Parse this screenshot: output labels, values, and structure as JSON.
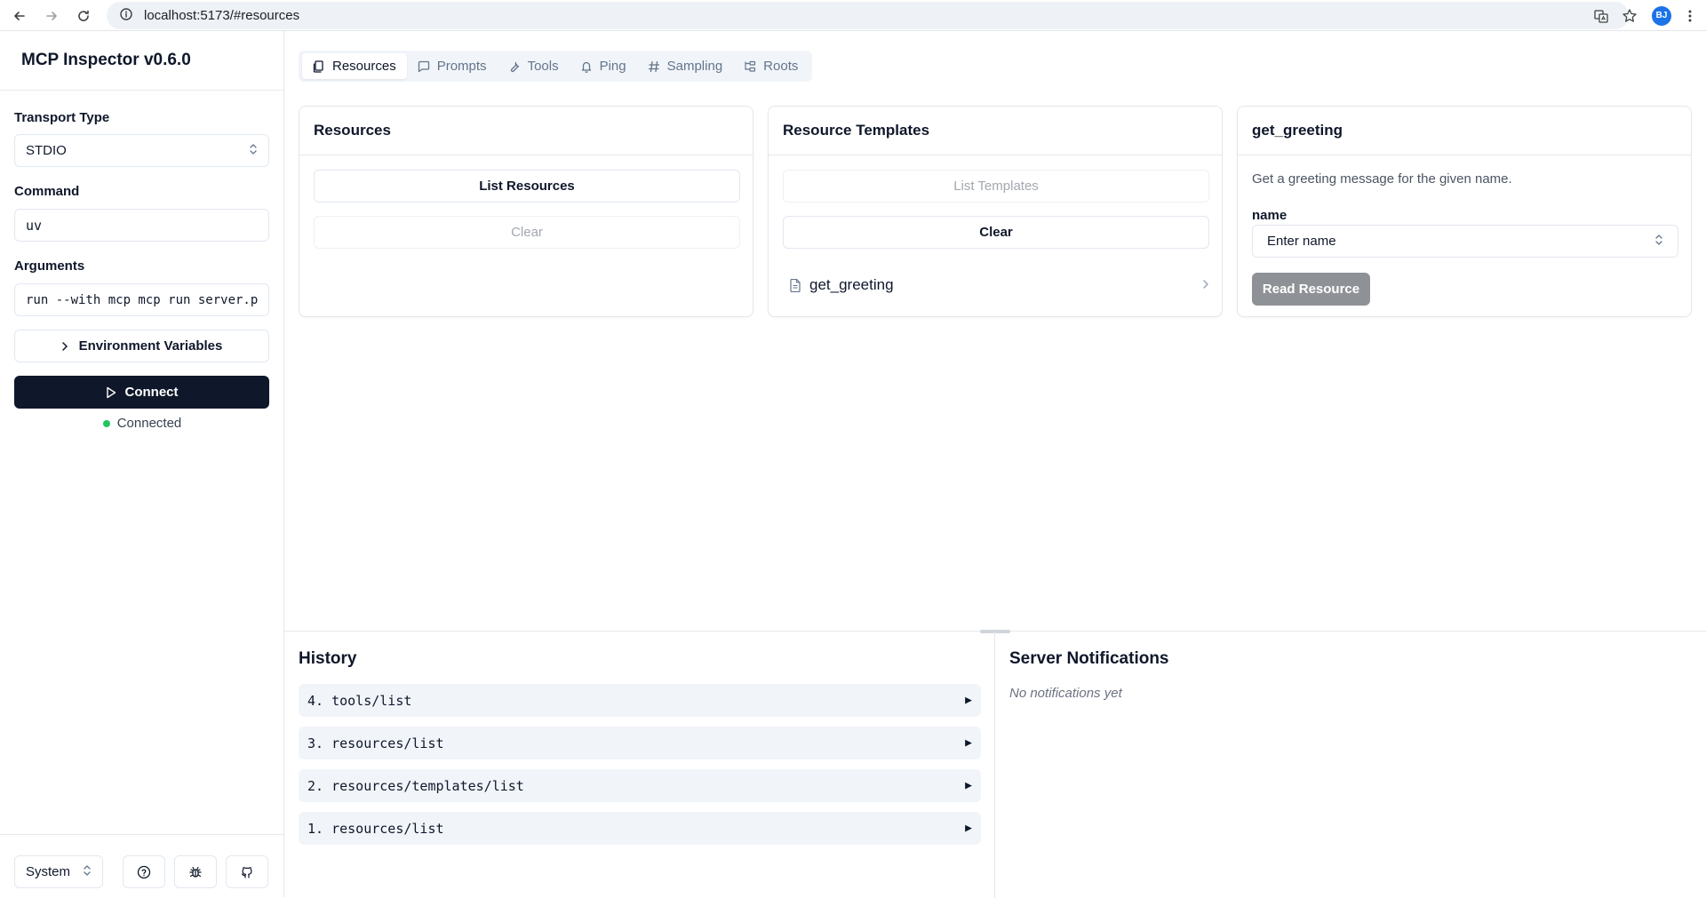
{
  "browser": {
    "url": "localhost:5173/#resources",
    "profile_initials": "BJ"
  },
  "sidebar": {
    "title": "MCP Inspector v0.6.0",
    "transport_label": "Transport Type",
    "transport_value": "STDIO",
    "command_label": "Command",
    "command_value": "uv",
    "arguments_label": "Arguments",
    "arguments_value": "run --with mcp mcp run server.p",
    "env_button": "Environment Variables",
    "connect_button": "Connect",
    "status": "Connected",
    "status_color": "#22c55e",
    "theme_value": "System"
  },
  "tabs": [
    {
      "label": "Resources",
      "active": true
    },
    {
      "label": "Prompts",
      "active": false
    },
    {
      "label": "Tools",
      "active": false
    },
    {
      "label": "Ping",
      "active": false
    },
    {
      "label": "Sampling",
      "active": false
    },
    {
      "label": "Roots",
      "active": false
    }
  ],
  "resources_card": {
    "title": "Resources",
    "list_button": "List Resources",
    "clear_button": "Clear"
  },
  "templates_card": {
    "title": "Resource Templates",
    "list_button": "List Templates",
    "clear_button": "Clear",
    "items": [
      {
        "label": "get_greeting"
      }
    ]
  },
  "detail_card": {
    "title": "get_greeting",
    "description": "Get a greeting message for the given name.",
    "name_label": "name",
    "name_placeholder": "Enter name",
    "read_button": "Read Resource"
  },
  "history": {
    "title": "History",
    "items": [
      {
        "label": "4. tools/list"
      },
      {
        "label": "3. resources/list"
      },
      {
        "label": "2. resources/templates/list"
      },
      {
        "label": "1. resources/list"
      }
    ]
  },
  "notifications": {
    "title": "Server Notifications",
    "empty_text": "No notifications yet"
  }
}
